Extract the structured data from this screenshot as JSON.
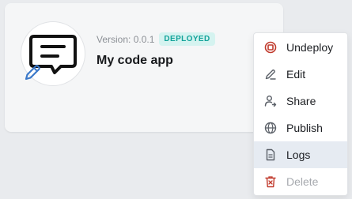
{
  "app": {
    "version_text": "Version: 0.0.1",
    "status": "DEPLOYED",
    "name": "My code app",
    "icon": "chat-message-icon",
    "edit_icon": "pencil-icon"
  },
  "menu": {
    "items": [
      {
        "label": "Undeploy",
        "icon": "undeploy-icon",
        "state": "normal"
      },
      {
        "label": "Edit",
        "icon": "edit-icon",
        "state": "normal"
      },
      {
        "label": "Share",
        "icon": "share-user-icon",
        "state": "normal"
      },
      {
        "label": "Publish",
        "icon": "globe-icon",
        "state": "normal"
      },
      {
        "label": "Logs",
        "icon": "document-icon",
        "state": "hovered"
      },
      {
        "label": "Delete",
        "icon": "trash-icon",
        "state": "disabled"
      }
    ]
  },
  "colors": {
    "badge_text": "#13a39a",
    "badge_bg": "#d5f3f0",
    "danger": "#c0392b",
    "pencil": "#3a78c9",
    "hover_bg": "#e6ebf2"
  }
}
